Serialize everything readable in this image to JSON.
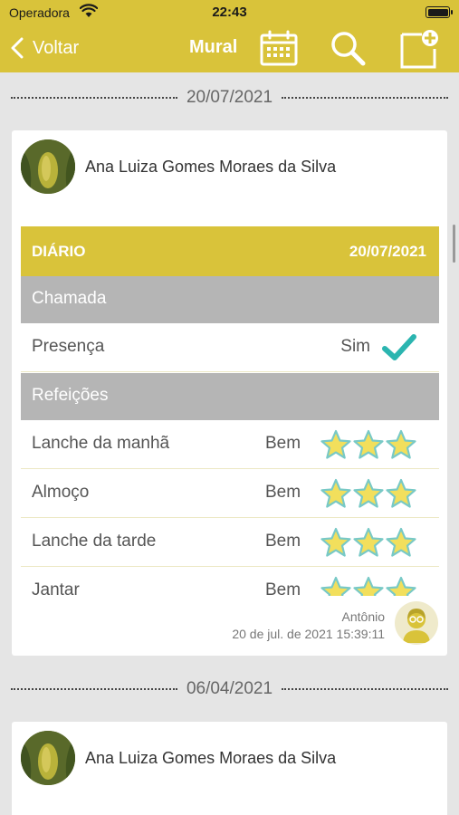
{
  "status_bar": {
    "carrier": "Operadora",
    "time": "22:43"
  },
  "nav": {
    "back_label": "Voltar",
    "title": "Mural",
    "icons": [
      "calendar-icon",
      "search-icon",
      "new-post-icon"
    ]
  },
  "colors": {
    "accent": "#d9c33a",
    "section": "#b5b5b5",
    "check": "#2bb5b0",
    "star": "#f2df5c",
    "star_outline": "#78c9c6"
  },
  "posts": [
    {
      "date": "20/07/2021",
      "author": "Ana Luiza Gomes Moraes da Silva",
      "diary": {
        "label": "DIÁRIO",
        "date": "20/07/2021",
        "sections": [
          {
            "title": "Chamada"
          },
          {
            "title": "Refeições"
          }
        ],
        "attendance": {
          "label": "Presença",
          "value": "Sim"
        },
        "meals": [
          {
            "label": "Lanche da manhã",
            "value": "Bem",
            "stars": 3
          },
          {
            "label": "Almoço",
            "value": "Bem",
            "stars": 3
          },
          {
            "label": "Lanche da tarde",
            "value": "Bem",
            "stars": 3
          },
          {
            "label": "Jantar",
            "value": "Bem",
            "stars": 3
          }
        ]
      },
      "footer": {
        "teacher": "Antônio",
        "timestamp": "20 de jul. de 2021 15:39:11"
      }
    },
    {
      "date": "06/04/2021",
      "author": "Ana Luiza Gomes Moraes da Silva"
    }
  ]
}
